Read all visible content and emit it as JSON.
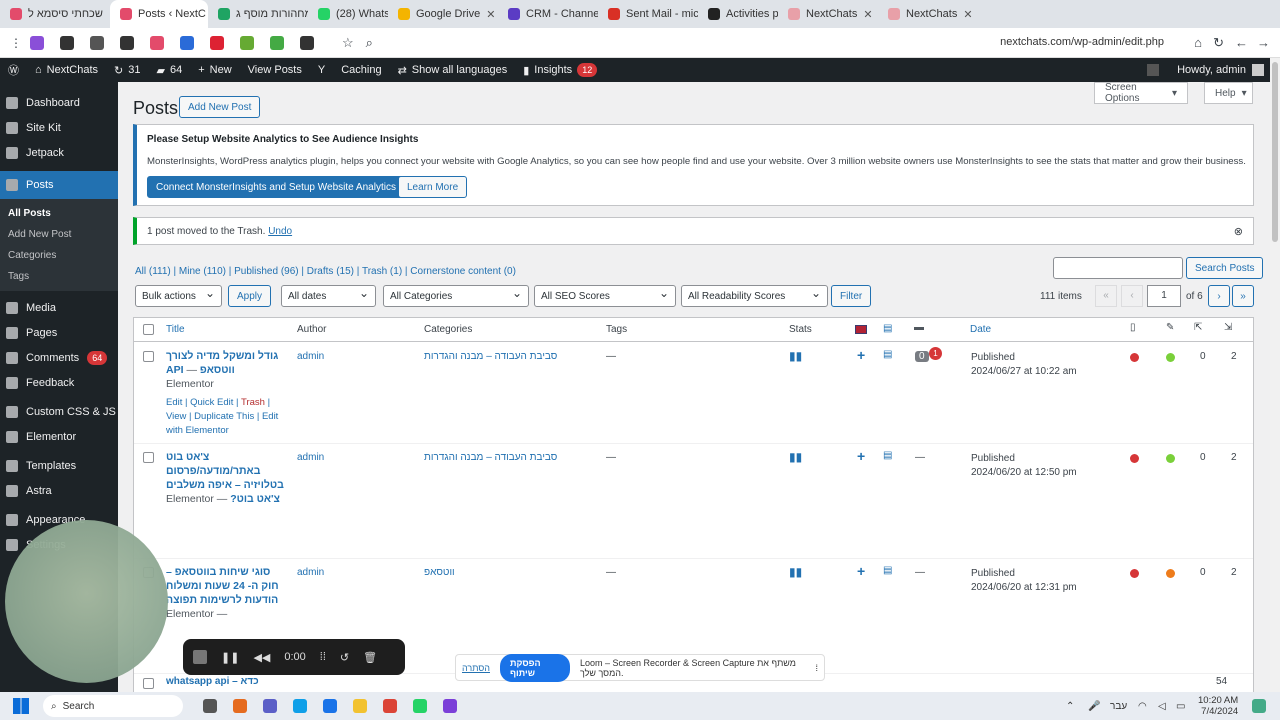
{
  "browser": {
    "tabs": [
      {
        "label": "שכחתי סיסמא ל",
        "color": "#e34b6b"
      },
      {
        "label": "Posts ‹ NextC",
        "color": "#e34b6b",
        "active": true
      },
      {
        "label": "מחהורות מוסף ג",
        "color": "#1fa463"
      },
      {
        "label": "(28) WhatsApp",
        "color": "#25d366"
      },
      {
        "label": "Google Drive",
        "color": "#f4b400"
      },
      {
        "label": "CRM - Channels |",
        "color": "#5b3cc4"
      },
      {
        "label": "Sent Mail - mich",
        "color": "#d93025"
      },
      {
        "label": "Activities page",
        "color": "#222222"
      },
      {
        "label": "NextChats",
        "color": "#e8a0a8"
      },
      {
        "label": "NextChats",
        "color": "#e8a0a8"
      }
    ],
    "url": "nextchats.com/wp-admin/edit.php"
  },
  "adminbar": {
    "site": "NextChats",
    "updates": "31",
    "comments": "64",
    "new": "New",
    "view_posts": "View Posts",
    "caching": "Caching",
    "languages": "Show all languages",
    "insights": "Insights",
    "insights_count": "12",
    "howdy": "Howdy, admin"
  },
  "sidebar": {
    "items": [
      {
        "label": "Dashboard"
      },
      {
        "label": "Site Kit"
      },
      {
        "label": "Jetpack"
      },
      {
        "label": "Posts"
      },
      {
        "label": "Media"
      },
      {
        "label": "Pages"
      },
      {
        "label": "Comments"
      },
      {
        "label": "Feedback"
      },
      {
        "label": "Custom CSS & JS"
      },
      {
        "label": "Elementor"
      },
      {
        "label": "Templates"
      },
      {
        "label": "Astra"
      },
      {
        "label": "Appearance"
      },
      {
        "label": "Settings"
      }
    ],
    "comments_badge": "64",
    "submenu": [
      "All Posts",
      "Add New Post",
      "Categories",
      "Tags"
    ]
  },
  "main": {
    "title": "Posts",
    "add_new": "Add New Post",
    "screen_options": "Screen Options",
    "help": "Help",
    "analytics_title": "Please Setup Website Analytics to See Audience Insights",
    "analytics_text": "MonsterInsights, WordPress analytics plugin, helps you connect your website with Google Analytics, so you can see how people find and use your website. Over 3 million website owners use MonsterInsights to see the stats that matter and grow their business.",
    "connect_btn": "Connect MonsterInsights and Setup Website Analytics",
    "learn_more": "Learn More",
    "trash_notice": "1 post moved to the Trash.",
    "undo": "Undo",
    "views": "All (111) | Mine (110) | Published (96) | Drafts (15) | Trash (1) | Cornerstone content (0)",
    "search_btn": "Search Posts",
    "bulk": "Bulk actions",
    "apply": "Apply",
    "dates": "All dates",
    "categories": "All Categories",
    "seo": "All SEO Scores",
    "readability": "All Readability Scores",
    "filter": "Filter",
    "items_count": "111 items",
    "page": "1",
    "of_pages": "of 6",
    "columns": {
      "title": "Title",
      "author": "Author",
      "categories": "Categories",
      "tags": "Tags",
      "stats": "Stats",
      "date": "Date"
    },
    "rows": [
      {
        "title": "גודל ומשקל מדיה לצורך ווטסאפ API",
        "suffix": "— Elementor",
        "author": "admin",
        "category": "סביבת העבודה – מבנה והגדרות",
        "tags": "—",
        "comments": "0",
        "comments_pending": "1",
        "status": "Published",
        "date": "2024/06/27 at 10:22 am",
        "links": "0",
        "count": "2",
        "read": "#d63638",
        "seo": "#7ad03a"
      },
      {
        "title": "צ'אט בוט באתר/מודעה/פרסום בטלויזיה – איפה משלבים צ'אט בוט?",
        "suffix": "— Elementor",
        "author": "admin",
        "category": "סביבת העבודה – מבנה והגדרות",
        "tags": "—",
        "comments": "—",
        "status": "Published",
        "date": "2024/06/20 at 12:50 pm",
        "links": "0",
        "count": "2",
        "read": "#d63638",
        "seo": "#7ad03a"
      },
      {
        "title": "סוגי שיחות בווטסאפ – חוק ה- 24 שעות ומשלוח הודעות לרשימות תפוצה",
        "suffix": "— Elementor",
        "author": "admin",
        "category": "ווטסאפ",
        "tags": "—",
        "comments": "—",
        "status": "Published",
        "date": "2024/06/20 at 12:31 pm",
        "links": "0",
        "count": "2",
        "read": "#d63638",
        "seo": "#ee7c1b"
      }
    ],
    "row_actions": {
      "edit": "Edit",
      "quick_edit": "Quick Edit",
      "trash": "Trash",
      "view": "View",
      "duplicate": "Duplicate This",
      "edit_elementor": "Edit with Elementor"
    },
    "peek_row": {
      "title": "whatsapp api – כדא",
      "count": "54"
    }
  },
  "recorder": {
    "time": "0:00"
  },
  "loom": {
    "text": "Loom – Screen Recorder & Screen Capture משתף את המסך שלך.",
    "stop": "הפסקת שיתוף",
    "hide": "הסתרה"
  },
  "taskbar": {
    "search": "Search",
    "lang": "עבר",
    "time": "10:20 AM",
    "date": "7/4/2024"
  }
}
